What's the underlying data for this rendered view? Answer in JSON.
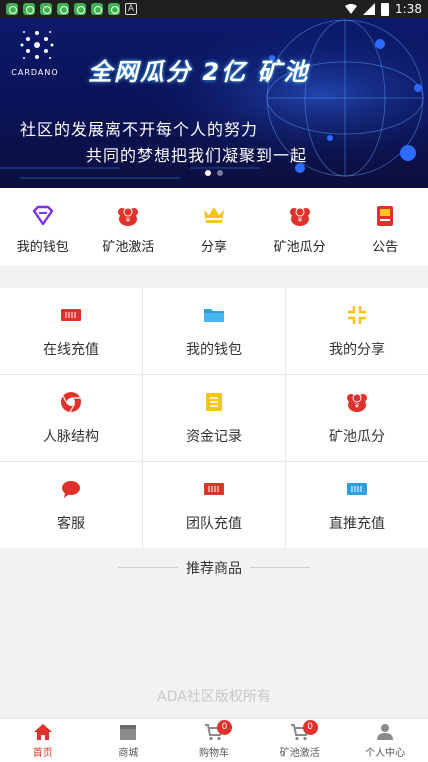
{
  "status_bar": {
    "time": "1:38",
    "notif_letter": "A"
  },
  "banner": {
    "logo_text": "CARDANO",
    "title": "全网瓜分 2亿 矿池",
    "line1": "社区的发展离不开每个人的努力",
    "line2": "共同的梦想把我们凝聚到一起",
    "colors": {
      "bg": "#0b1a6a",
      "accent": "#4db4ff"
    }
  },
  "quick_nav": [
    {
      "label": "我的钱包",
      "icon": "diamond-icon"
    },
    {
      "label": "矿池激活",
      "icon": "money-bag-icon"
    },
    {
      "label": "分享",
      "icon": "crown-icon"
    },
    {
      "label": "矿池瓜分",
      "icon": "money-bag-icon"
    },
    {
      "label": "公告",
      "icon": "notice-icon"
    }
  ],
  "grid": [
    {
      "label": "在线充值",
      "icon": "card-icon"
    },
    {
      "label": "我的钱包",
      "icon": "folder-icon"
    },
    {
      "label": "我的分享",
      "icon": "share-arrows-icon"
    },
    {
      "label": "人脉结构",
      "icon": "chrome-network-icon"
    },
    {
      "label": "资金记录",
      "icon": "notebook-icon"
    },
    {
      "label": "矿池瓜分",
      "icon": "money-bag-icon"
    },
    {
      "label": "客服",
      "icon": "chat-bubble-icon"
    },
    {
      "label": "团队充值",
      "icon": "card-icon"
    },
    {
      "label": "直推充值",
      "icon": "card-icon"
    }
  ],
  "recommend": {
    "title": "推荐商品",
    "copyright": "ADA社区版权所有"
  },
  "tab_bar": [
    {
      "label": "首页",
      "icon": "home-icon",
      "active": true
    },
    {
      "label": "商城",
      "icon": "store-icon"
    },
    {
      "label": "购物车",
      "icon": "cart-icon",
      "badge": "0"
    },
    {
      "label": "矿池激活",
      "icon": "cart-icon",
      "badge": "0"
    },
    {
      "label": "个人中心",
      "icon": "user-icon"
    }
  ],
  "colors": {
    "red": "#e0322b",
    "yellow": "#f5c518",
    "purple": "#7b2ff2",
    "blue": "#2f9fe3"
  }
}
